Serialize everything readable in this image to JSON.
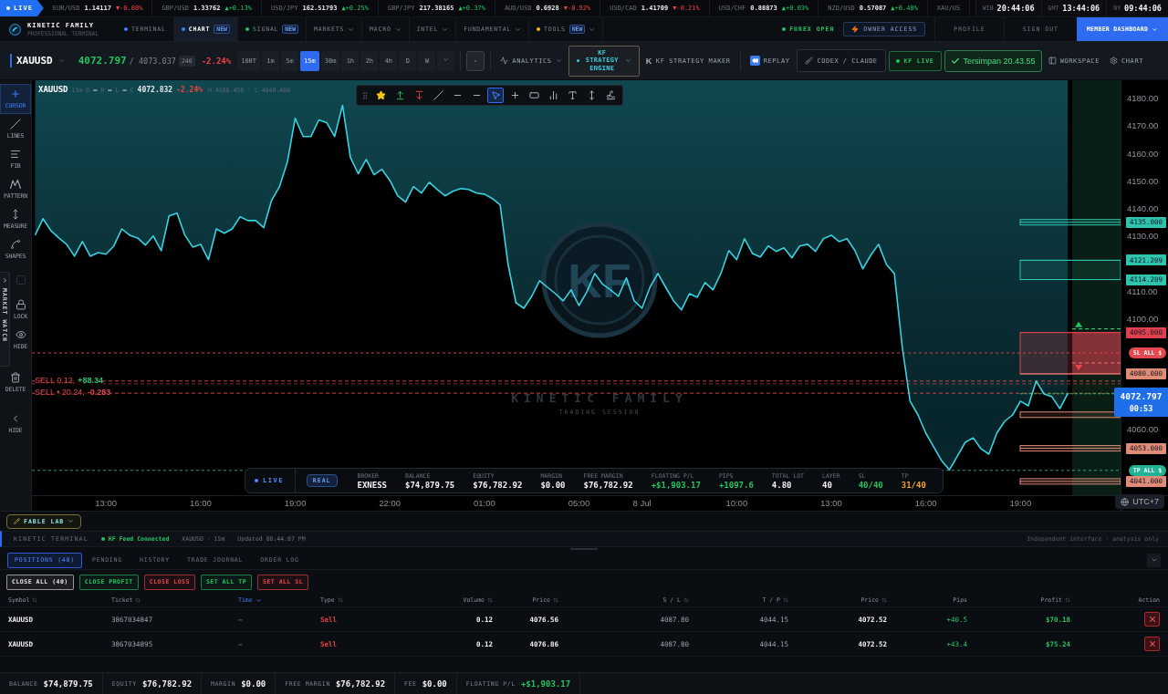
{
  "ticker": {
    "live": "LIVE",
    "quotes": [
      {
        "pair": "EUR/USD",
        "price": "1.14117",
        "change": "▼-0.08%",
        "rising": false
      },
      {
        "pair": "GBP/USD",
        "price": "1.33762",
        "change": "▲+0.13%",
        "rising": true
      },
      {
        "pair": "USD/JPY",
        "price": "162.51793",
        "change": "▲+0.25%",
        "rising": true
      },
      {
        "pair": "GBP/JPY",
        "price": "217.38165",
        "change": "▲+0.37%",
        "rising": true
      },
      {
        "pair": "AUD/USD",
        "price": "0.6928",
        "change": "▼-0.92%",
        "rising": false
      },
      {
        "pair": "USD/CAD",
        "price": "1.41709",
        "change": "▼-0.21%",
        "rising": false
      },
      {
        "pair": "USD/CHF",
        "price": "0.88873",
        "change": "▲+0.03%",
        "rising": true
      },
      {
        "pair": "NZD/USD",
        "price": "0.57087",
        "change": "▲+0.48%",
        "rising": true
      },
      {
        "pair": "XAU/US"
      }
    ],
    "clocks": [
      {
        "zone": "WIB",
        "time": "20:44:06"
      },
      {
        "zone": "GMT",
        "time": "13:44:06"
      },
      {
        "zone": "NY",
        "time": "09:44:06"
      }
    ]
  },
  "nav": {
    "brand": "KINETIC FAMILY",
    "tagline": "PROFESSIONAL TERMINAL",
    "tabs": [
      {
        "label": "TERMINAL",
        "selected": false,
        "color": "#3b82f6",
        "dropdown": false
      },
      {
        "label": "CHART",
        "selected": true,
        "color": "#3b82f6",
        "badge": "NEW",
        "dropdown": false
      },
      {
        "label": "SIGNAL",
        "selected": false,
        "color": "#22c55e",
        "badge": "NEW",
        "dropdown": false
      },
      {
        "label": "MARKETS",
        "selected": false,
        "dropdown": true
      },
      {
        "label": "MACRO",
        "selected": false,
        "dropdown": true
      },
      {
        "label": "INTEL",
        "selected": false,
        "dropdown": true
      },
      {
        "label": "FUNDAMENTAL",
        "selected": false,
        "dropdown": true
      },
      {
        "label": "TOOLS",
        "selected": false,
        "color": "#f5b50b",
        "badge": "NEW",
        "dropdown": true
      }
    ],
    "market_status": "FOREX OPEN",
    "owner_access": "OWNER ACCESS",
    "links": [
      "PROFILE",
      "SIGN OUT"
    ],
    "dashboard": "MEMBER DASHBOARD"
  },
  "toolbar": {
    "symbol": "XAUUSD",
    "bid": "4072.797",
    "ask": "/ 4073.037",
    "spread": "240",
    "change": "-2.24%",
    "timeframes": [
      {
        "label": "100T",
        "selected": false
      },
      {
        "label": "1m",
        "selected": false
      },
      {
        "label": "5m",
        "selected": false
      },
      {
        "label": "15m",
        "selected": true
      },
      {
        "label": "30m",
        "selected": false
      },
      {
        "label": "1h",
        "selected": false
      },
      {
        "label": "2h",
        "selected": false
      },
      {
        "label": "4h",
        "selected": false
      },
      {
        "label": "D",
        "selected": false
      },
      {
        "label": "W",
        "selected": false
      }
    ],
    "analytics": "ANALYTICS",
    "strategy_engine": "KF STRATEGY ENGINE",
    "strategy_maker": {
      "glyph": "K",
      "label": "KF STRATEGY MAKER"
    },
    "replay": "REPLAY",
    "assistant": "CODEX / CLAUDE",
    "live_feed": "KF LIVE",
    "saved": "Tersimpan 20.43.55",
    "workspace": "WORKSPACE",
    "chart_settings": "CHART"
  },
  "sidebar": {
    "tools": [
      {
        "kind": "cursor",
        "label": "CURSOR",
        "selected": true,
        "disabled": false
      },
      {
        "kind": "lines",
        "label": "LINES",
        "selected": false,
        "disabled": false
      },
      {
        "kind": "fib",
        "label": "FIB",
        "selected": false,
        "disabled": false
      },
      {
        "kind": "pattern",
        "label": "PATTERN",
        "selected": false,
        "disabled": false
      },
      {
        "kind": "measure",
        "label": "MEASURE",
        "selected": false,
        "disabled": false
      },
      {
        "kind": "shapes",
        "label": "SHAPES",
        "selected": false,
        "disabled": false
      },
      {
        "kind": "box",
        "selected": false,
        "disabled": true
      },
      {
        "kind": "lock",
        "label": "LOCK",
        "selected": false,
        "disabled": false
      },
      {
        "kind": "hide",
        "label": "HIDE",
        "selected": false,
        "disabled": false
      },
      {
        "kind": "delete",
        "label": "DELETE",
        "selected": false,
        "disabled": false
      },
      {
        "kind": "collapse",
        "label": "HIDE",
        "selected": false,
        "disabled": false
      }
    ],
    "market_watch": "MARKET WATCH"
  },
  "chart": {
    "legend": {
      "timeframe": "15m",
      "ohlc": [
        {
          "key": "O",
          "value": "—"
        },
        {
          "key": "H",
          "value": "—"
        },
        {
          "key": "L",
          "value": "—"
        },
        {
          "key": "C",
          "value": "4072.832"
        }
      ],
      "change": "-2.24%",
      "range": "H 4180.456 · L 4040.406"
    },
    "drawing_tools": [
      {
        "kind": "favorite",
        "selected": false
      },
      {
        "kind": "long",
        "selected": false
      },
      {
        "kind": "short",
        "selected": false
      },
      {
        "kind": "trend",
        "selected": false
      },
      {
        "kind": "hline",
        "selected": false
      },
      {
        "kind": "ray",
        "selected": false
      },
      {
        "kind": "pointer",
        "selected": true
      },
      {
        "kind": "crosshair",
        "selected": false
      },
      {
        "kind": "rectangle",
        "selected": false
      },
      {
        "kind": "bars",
        "selected": false
      },
      {
        "kind": "text",
        "selected": false
      },
      {
        "kind": "range",
        "selected": false
      },
      {
        "kind": "brush",
        "selected": false
      }
    ],
    "watermark": {
      "monogram": "KF",
      "title": "KINETIC FAMILY",
      "subtitle": "TRADING SESSION"
    },
    "chart_data": {
      "type": "line",
      "categories": [
        null,
        null,
        null,
        null,
        null,
        null,
        null,
        null,
        null,
        "13:00",
        null,
        null,
        null,
        null,
        null,
        null,
        null,
        null,
        null,
        null,
        null,
        "16:00",
        null,
        null,
        null,
        null,
        null,
        null,
        null,
        null,
        null,
        null,
        null,
        "19:00",
        null,
        null,
        null,
        null,
        null,
        null,
        null,
        null,
        null,
        null,
        null,
        "22:00",
        null,
        null,
        null,
        null,
        null,
        null,
        null,
        null,
        null,
        null,
        null,
        "01:00",
        null,
        null,
        null,
        null,
        null,
        null,
        null,
        null,
        null,
        null,
        null,
        "05:00",
        null,
        null,
        null,
        null,
        null,
        null,
        null,
        "8 Jul",
        null,
        null,
        null,
        null,
        null,
        null,
        null,
        null,
        null,
        null,
        null,
        "10:00",
        null,
        null,
        null,
        null,
        null,
        null,
        null,
        null,
        null,
        null,
        null,
        "13:00",
        null,
        null,
        null,
        null,
        null,
        null,
        null,
        null,
        null,
        null,
        null,
        "16:00",
        null,
        null,
        null,
        null,
        null,
        null,
        null,
        null,
        null,
        null,
        null,
        "19:00",
        null,
        null,
        null,
        null,
        null,
        null,
        null,
        null,
        null,
        null,
        null,
        null
      ],
      "series": [
        {
          "name": "XAUUSD",
          "color": "#38d3e3",
          "values": [
            4130.3,
            4136.3,
            4132.0,
            4129.3,
            4127.0,
            4122.7,
            4128.0,
            4122.7,
            4124.0,
            4123.4,
            4126.4,
            4132.6,
            4130.3,
            4129.3,
            4126.7,
            4130.0,
            4124.7,
            4137.3,
            4138.3,
            4130.3,
            4126.0,
            4127.0,
            4121.4,
            4132.6,
            4131.0,
            4132.6,
            4137.0,
            4135.6,
            4135.6,
            4133.0,
            4142.9,
            4147.9,
            4156.8,
            4172.7,
            4166.1,
            4166.1,
            4172.1,
            4171.1,
            4166.1,
            4177.4,
            4158.5,
            4152.6,
            4157.8,
            4152.2,
            4154.2,
            4150.2,
            4144.6,
            4142.3,
            4147.9,
            4145.6,
            4149.5,
            4146.9,
            4144.6,
            4146.2,
            4147.2,
            4146.9,
            4145.6,
            4145.2,
            4143.6,
            4141.3,
            4119.7,
            4105.8,
            4103.8,
            4108.1,
            4113.8,
            4111.4,
            4109.1,
            4106.5,
            4110.5,
            4104.8,
            4109.8,
            4116.4,
            4112.5,
            4110.5,
            4108.1,
            4114.8,
            4106.5,
            4103.8,
            4111.4,
            4116.4,
            4111.4,
            4106.5,
            4103.2,
            4109.1,
            4107.8,
            4113.1,
            4110.5,
            4116.4,
            4124.7,
            4121.4,
            4129.0,
            4123.7,
            4122.4,
            4126.4,
            4124.4,
            4125.7,
            4122.1,
            4126.4,
            4127.0,
            4124.4,
            4129.0,
            4130.3,
            4128.0,
            4129.0,
            4124.7,
            4118.1,
            4123.0,
            4127.0,
            4119.7,
            4116.4,
            4089.9,
            4070.1,
            4065.1,
            4058.5,
            4053.5,
            4048.5,
            4045.2,
            4050.2,
            4055.2,
            4056.8,
            4052.8,
            4050.9,
            4058.5,
            4062.8,
            4065.1,
            4070.1,
            4068.4,
            4077.4,
            4072.7,
            4071.7,
            4067.4,
            4072.8,
            null,
            null,
            null,
            null,
            null,
            null
          ]
        }
      ],
      "ylim": [
        4036,
        4186.5
      ],
      "yticks": [
        {
          "value": 4180,
          "label": "4180.00"
        },
        {
          "value": 4170,
          "label": "4170.00"
        },
        {
          "value": 4160,
          "label": "4160.00"
        },
        {
          "value": 4150,
          "label": "4150.00"
        },
        {
          "value": 4140,
          "label": "4140.00"
        },
        {
          "value": 4130,
          "label": "4130.00"
        },
        {
          "value": 4110,
          "label": "4110.00"
        },
        {
          "value": 4100,
          "label": "4100.00"
        },
        {
          "value": 4060,
          "label": "4060.00"
        }
      ],
      "ref_lines": [
        {
          "axis": "y",
          "value": 4135,
          "label": "4135.000"
        },
        {
          "axis": "y",
          "value": 4121.209,
          "label": "4121.209"
        },
        {
          "axis": "y",
          "value": 4114.209,
          "label": "4114.209"
        },
        {
          "axis": "y",
          "value": 4095,
          "label": "4095.000"
        },
        {
          "axis": "y",
          "value": 4080,
          "label": "4080.000"
        },
        {
          "axis": "y",
          "value": 4087.6,
          "label": "SL ALL $"
        },
        {
          "axis": "y",
          "value": 4077.4,
          "label": "SELL 0.12,"
        },
        {
          "axis": "y",
          "value": 4073.0,
          "label": "SELL • 20.24,"
        },
        {
          "axis": "y",
          "value": 4072.797,
          "label": "4072.797"
        },
        {
          "axis": "y",
          "value": 4053,
          "label": "4053.000"
        },
        {
          "axis": "y",
          "value": 4045,
          "label": "TP ALL $"
        },
        {
          "axis": "y",
          "value": 4041,
          "label": "4041.000"
        }
      ]
    },
    "levels": [
      {
        "kind": "boxed",
        "color": "#2ec4ad"
      },
      {
        "kind": "target",
        "color": "#2ec4ad"
      },
      {
        "kind": "tag",
        "color": "#2ec4ad"
      },
      {
        "kind": "stop",
        "color": "#e0414f"
      },
      {
        "kind": "tag",
        "color": "#e08a78"
      },
      {
        "kind": "pill",
        "color": "#e5484d"
      },
      {
        "kind": "order",
        "value": "+88.34",
        "color": "#2fbf71"
      },
      {
        "kind": "order",
        "value": "-0.283",
        "color": "#e5484d"
      },
      {
        "kind": "current",
        "countdown": "00:53",
        "color": "#1f6feb"
      },
      {
        "kind": "boxed",
        "color": "#e08a78"
      },
      {
        "kind": "pill",
        "color": "#21b294"
      },
      {
        "kind": "boxed",
        "color": "#e08a78"
      }
    ],
    "account": {
      "live": "LIVE",
      "mode": "REAL",
      "fields": [
        {
          "label": "BROKER",
          "value": "EXNESS"
        },
        {
          "label": "BALANCE",
          "value": "$74,879.75"
        },
        {
          "label": "EQUITY",
          "value": "$76,782.92"
        },
        {
          "label": "MARGIN",
          "value": "$0.00"
        },
        {
          "label": "FREE MARGIN",
          "value": "$76,782.92"
        },
        {
          "label": "FLOATING P/L",
          "value": "+$1,903.17",
          "color": "#22c55e"
        },
        {
          "label": "PIPS",
          "value": "+1097.6",
          "color": "#22c55e"
        },
        {
          "label": "TOTAL LOT",
          "value": "4.80"
        },
        {
          "label": "LAYER",
          "value": "40"
        },
        {
          "label": "SL",
          "value": "40/40",
          "color": "#22c55e"
        },
        {
          "label": "TP",
          "value": "31/40",
          "color": "#f5a524"
        }
      ]
    },
    "timezone": "UTC+7"
  },
  "panel": {
    "fable_lab": "FABLE LAB",
    "status": {
      "terminal": "KINETIC TERMINAL",
      "feed": "KF Feed Connected",
      "context": "XAUUSD · 15m",
      "updated": "Updated 08:44:07 PM",
      "note": "Independent interface · analysis only"
    },
    "tabs": [
      {
        "label": "POSITIONS (40)",
        "selected": true
      },
      {
        "label": "PENDING",
        "selected": false
      },
      {
        "label": "HISTORY",
        "selected": false
      },
      {
        "label": "TRADE JOURNAL",
        "selected": false
      },
      {
        "label": "ORDER LOG",
        "selected": false
      }
    ],
    "actions": [
      {
        "label": "CLOSE ALL (40)",
        "color": "#e5e7eb"
      },
      {
        "label": "CLOSE PROFIT",
        "color": "#22c55e"
      },
      {
        "label": "CLOSE LOSS",
        "color": "#ef4444"
      },
      {
        "label": "SET ALL TP",
        "color": "#22c55e"
      },
      {
        "label": "SET ALL SL",
        "color": "#ef4444"
      }
    ],
    "table": {
      "columns": [
        {
          "label": "Symbol",
          "sortable": true,
          "sorted": false
        },
        {
          "label": "Ticket",
          "sortable": true,
          "sorted": false
        },
        {
          "label": "Time",
          "sortable": true,
          "sorted": true
        },
        {
          "label": "Type",
          "sortable": true,
          "sorted": false
        },
        {
          "label": "Volume",
          "sortable": true,
          "sorted": false
        },
        {
          "label": "Price",
          "sortable": true,
          "sorted": false
        },
        {
          "label": "S / L",
          "sortable": true,
          "sorted": false
        },
        {
          "label": "T / P",
          "sortable": true,
          "sorted": false
        },
        {
          "label": "Price",
          "sortable": true,
          "sorted": false
        },
        {
          "label": "Pips",
          "sortable": false,
          "sorted": false
        },
        {
          "label": "Profit",
          "sortable": true,
          "sorted": false
        },
        {
          "label": "Action",
          "sortable": false,
          "sorted": false
        }
      ],
      "rows": [
        {
          "cells": [
            "XAUUSD",
            "3867034847",
            "—",
            "Sell",
            "0.12",
            "4076.56",
            "4087.80",
            "4044.15",
            "4072.52",
            "+40.5",
            "$70.18"
          ]
        },
        {
          "cells": [
            "XAUUSD",
            "3867034895",
            "—",
            "Sell",
            "0.12",
            "4076.86",
            "4087.80",
            "4044.15",
            "4072.52",
            "+43.4",
            "$75.24"
          ]
        }
      ]
    }
  },
  "footer": [
    {
      "label": "BALANCE",
      "value": "$74,879.75"
    },
    {
      "label": "EQUITY",
      "value": "$76,782.92"
    },
    {
      "label": "MARGIN",
      "value": "$0.00"
    },
    {
      "label": "FREE MARGIN",
      "value": "$76,782.92"
    },
    {
      "label": "FEE",
      "value": "$0.00"
    },
    {
      "label": "FLOATING P/L",
      "value": "+$1,903.17",
      "color": "#22c55e"
    }
  ]
}
